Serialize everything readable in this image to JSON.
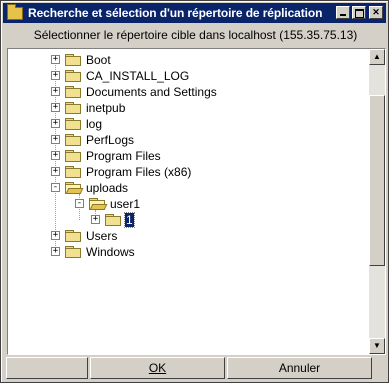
{
  "window": {
    "title": "Recherche et sélection d'un répertoire de réplication",
    "icon": "folder-icon",
    "controls": [
      "minimize-icon",
      "maximize-icon",
      "close-icon"
    ]
  },
  "subtitle": "Sélectionner le répertoire cible dans localhost (155.35.75.13)",
  "tree": {
    "items": [
      {
        "label": "Boot",
        "expander": "+",
        "folder": "closed"
      },
      {
        "label": "CA_INSTALL_LOG",
        "expander": "+",
        "folder": "closed"
      },
      {
        "label": "Documents and Settings",
        "expander": "+",
        "folder": "closed"
      },
      {
        "label": "inetpub",
        "expander": "+",
        "folder": "closed"
      },
      {
        "label": "log",
        "expander": "+",
        "folder": "closed"
      },
      {
        "label": "PerfLogs",
        "expander": "+",
        "folder": "closed"
      },
      {
        "label": "Program Files",
        "expander": "+",
        "folder": "closed"
      },
      {
        "label": "Program Files (x86)",
        "expander": "+",
        "folder": "closed"
      },
      {
        "label": "uploads",
        "expander": "-",
        "folder": "open"
      },
      {
        "label": "user1",
        "expander": "-",
        "folder": "open"
      },
      {
        "label": "1",
        "expander": "+",
        "folder": "closed",
        "selected": true
      },
      {
        "label": "Users",
        "expander": "+",
        "folder": "closed"
      },
      {
        "label": "Windows",
        "expander": "+",
        "folder": "closed"
      }
    ]
  },
  "scrollbar": {
    "up_icon": "arrow-up-icon",
    "down_icon": "arrow-down-icon"
  },
  "buttons": {
    "left": "",
    "ok": "OK",
    "cancel": "Annuler"
  }
}
